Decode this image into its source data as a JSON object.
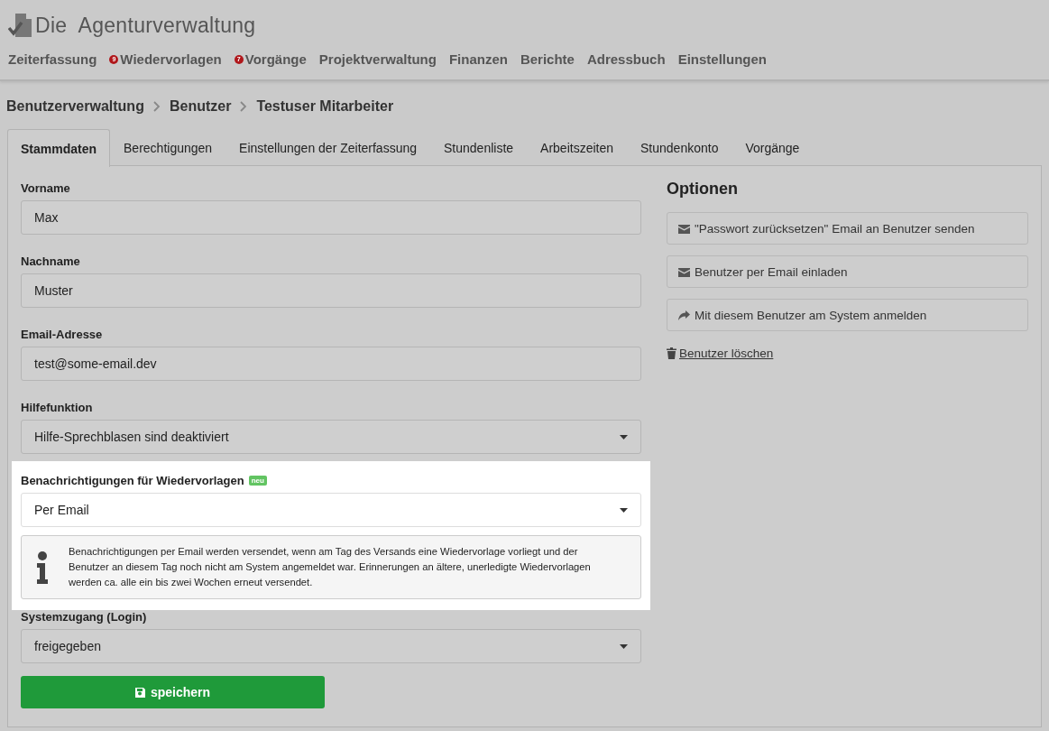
{
  "app": {
    "title": "Die  Agenturverwaltung"
  },
  "nav": [
    {
      "label": "Zeiterfassung"
    },
    {
      "label": "Wiedervorlagen",
      "badge": "9"
    },
    {
      "label": "Vorgänge",
      "badge": "7"
    },
    {
      "label": "Projektverwaltung"
    },
    {
      "label": "Finanzen"
    },
    {
      "label": "Berichte"
    },
    {
      "label": "Adressbuch"
    },
    {
      "label": "Einstellungen"
    }
  ],
  "breadcrumb": [
    "Benutzerverwaltung",
    "Benutzer",
    "Testuser Mitarbeiter"
  ],
  "tabs": [
    {
      "label": "Stammdaten",
      "selected": true
    },
    {
      "label": "Berechtigungen",
      "selected": false
    },
    {
      "label": "Einstellungen der Zeiterfassung",
      "selected": false
    },
    {
      "label": "Stundenliste",
      "selected": false
    },
    {
      "label": "Arbeitszeiten",
      "selected": false
    },
    {
      "label": "Stundenkonto",
      "selected": false
    },
    {
      "label": "Vorgänge",
      "selected": false
    }
  ],
  "fields": [
    {
      "label": "Vorname",
      "kind": "text",
      "value": "Max",
      "highlighted": false
    },
    {
      "label": "Nachname",
      "kind": "text",
      "value": "Muster",
      "highlighted": false
    },
    {
      "label": "Email-Adresse",
      "kind": "text",
      "value": "test@some-email.dev",
      "highlighted": false
    },
    {
      "label": "Hilfefunktion",
      "kind": "select",
      "value": "Hilfe-Sprechblasen sind deaktiviert",
      "highlighted": false
    },
    {
      "label": "Benachrichtigungen für Wiedervorlagen",
      "badge": "neu",
      "kind": "select",
      "value": "Per Email",
      "highlighted": true,
      "note": "Benachrichtigungen per Email werden versendet, wenn am Tag des Versands eine Wiedervorlage vorliegt und der Benutzer an diesem Tag noch nicht am System angemeldet war. Erinnerungen an ältere, unerledigte Wiedervorlagen werden ca. alle ein bis zwei Wochen erneut versendet."
    },
    {
      "label": "Systemzugang (Login)",
      "kind": "select",
      "value": "freigegeben",
      "highlighted": false
    }
  ],
  "save_button": "speichern",
  "options": {
    "title": "Optionen",
    "buttons": [
      {
        "label": "\"Passwort zurücksetzen\" Email an Benutzer senden",
        "kind": "email"
      },
      {
        "label": "Benutzer per Email einladen",
        "kind": "email"
      },
      {
        "label": "Mit diesem Benutzer am System anmelden",
        "kind": "login"
      }
    ],
    "delete_link": "Benutzer löschen"
  }
}
